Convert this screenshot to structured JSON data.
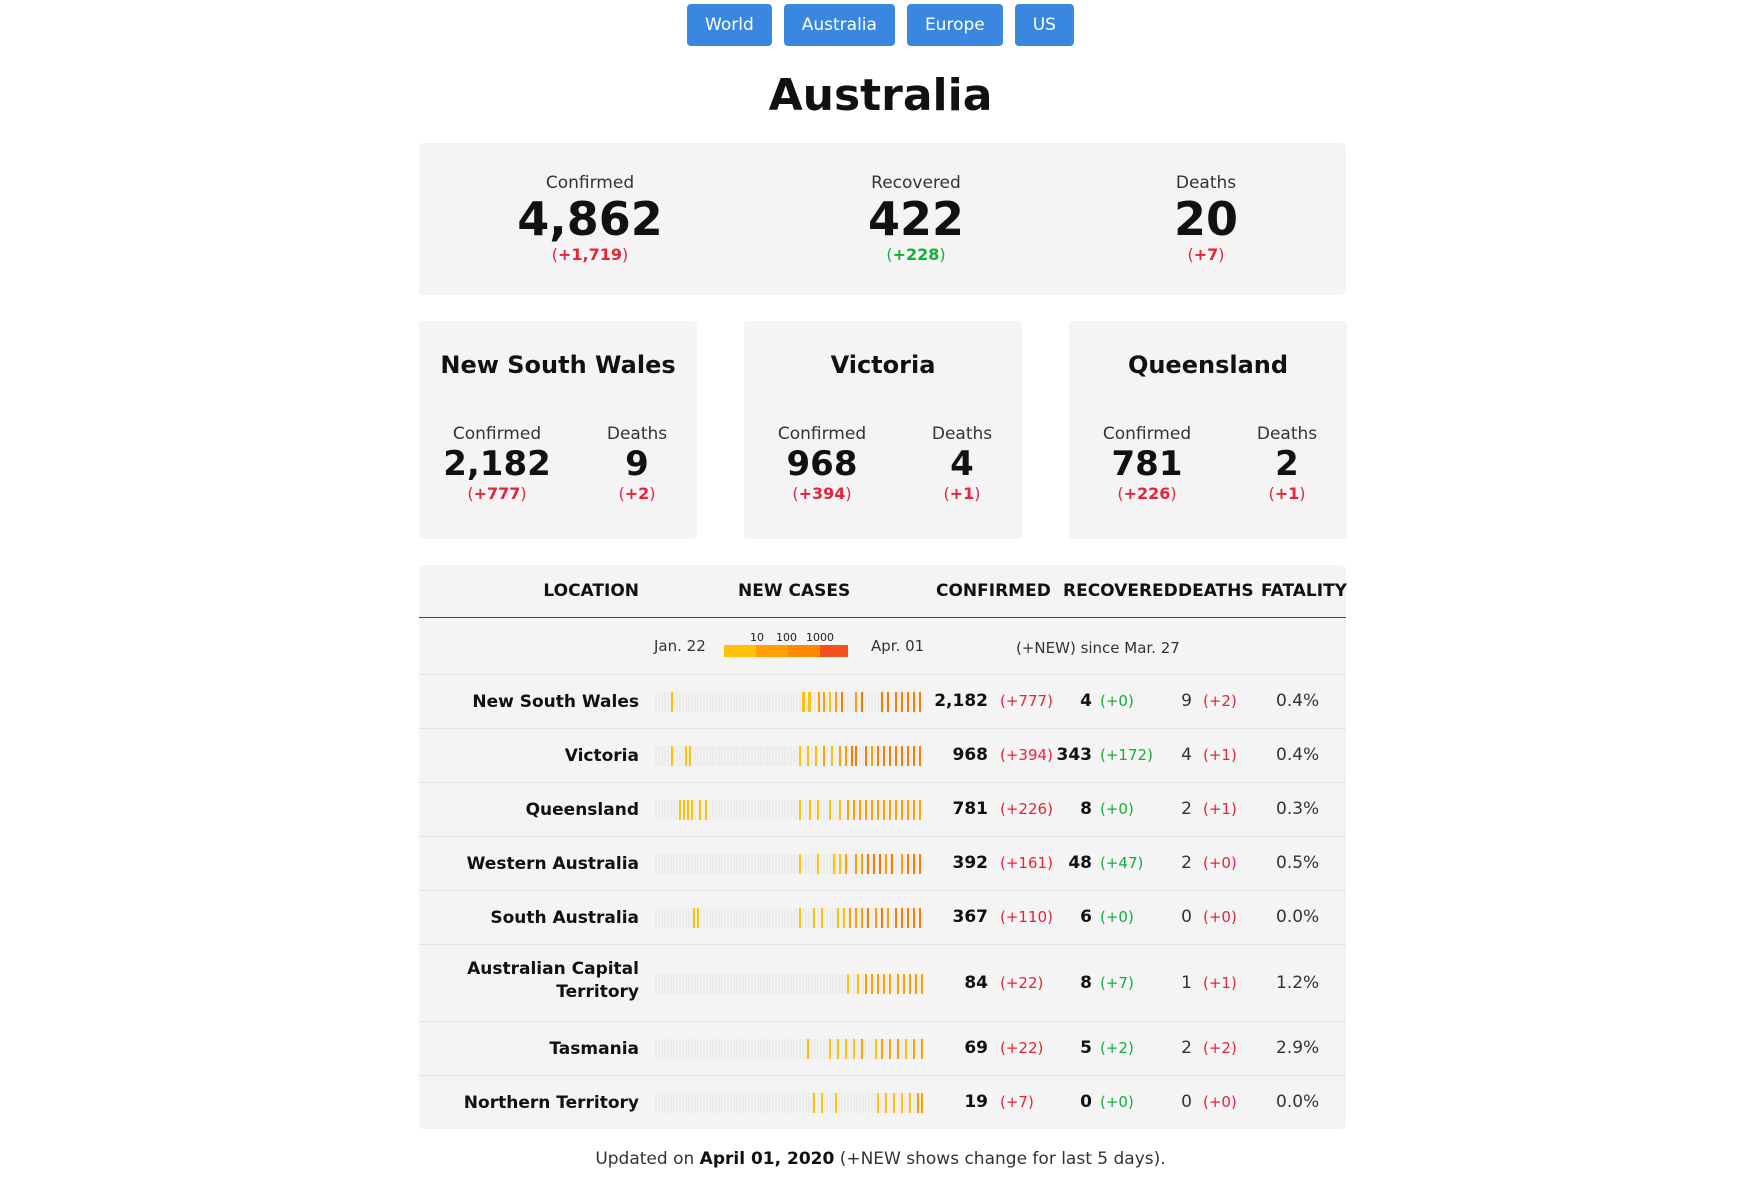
{
  "nav": [
    "World",
    "Australia",
    "Europe",
    "US"
  ],
  "title": "Australia",
  "summary": {
    "confirmed": {
      "label": "Confirmed",
      "value": "4,862",
      "change": "+1,719"
    },
    "recovered": {
      "label": "Recovered",
      "value": "422",
      "change": "+228"
    },
    "deaths": {
      "label": "Deaths",
      "value": "20",
      "change": "+7"
    }
  },
  "states": [
    {
      "name": "New South Wales",
      "confirmed_label": "Confirmed",
      "confirmed": "2,182",
      "confirmed_change": "+777",
      "deaths_label": "Deaths",
      "deaths": "9",
      "deaths_change": "+2"
    },
    {
      "name": "Victoria",
      "confirmed_label": "Confirmed",
      "confirmed": "968",
      "confirmed_change": "+394",
      "deaths_label": "Deaths",
      "deaths": "4",
      "deaths_change": "+1"
    },
    {
      "name": "Queensland",
      "confirmed_label": "Confirmed",
      "confirmed": "781",
      "confirmed_change": "+226",
      "deaths_label": "Deaths",
      "deaths": "2",
      "deaths_change": "+1"
    }
  ],
  "table": {
    "headers": {
      "location": "LOCATION",
      "new_cases": "NEW CASES",
      "confirmed": "CONFIRMED",
      "recovered": "RECOVERED",
      "deaths": "DEATHS",
      "fatality": "FATALITY"
    },
    "legend": {
      "start": "Jan. 22",
      "end": "Apr. 01",
      "scale": [
        "10",
        "100",
        "1000"
      ],
      "note": "(+NEW) since Mar. 27"
    },
    "rows": [
      {
        "location": "New South Wales",
        "confirmed": "2,182",
        "confirmed_change": "+777",
        "recovered": "4",
        "recovered_change": "+0",
        "deaths": "9",
        "deaths_change": "+2",
        "fatality": "0.4%",
        "spark": "0000X0000000000000000000000000000000000000000000000000000000000000000000000000000000000000000000000000000000000000000000000000000000000000000000000000000000000000000000000000000000000000000000000000000000000000000000000000000000000000000000000000000000000000000000000000000000000"
      },
      {
        "location": "Victoria",
        "confirmed": "968",
        "confirmed_change": "+394",
        "recovered": "343",
        "recovered_change": "+172",
        "deaths": "4",
        "deaths_change": "+1",
        "fatality": "0.4%"
      },
      {
        "location": "Queensland",
        "confirmed": "781",
        "confirmed_change": "+226",
        "recovered": "8",
        "recovered_change": "+0",
        "deaths": "2",
        "deaths_change": "+1",
        "fatality": "0.3%"
      },
      {
        "location": "Western Australia",
        "confirmed": "392",
        "confirmed_change": "+161",
        "recovered": "48",
        "recovered_change": "+47",
        "deaths": "2",
        "deaths_change": "+0",
        "fatality": "0.5%"
      },
      {
        "location": "South Australia",
        "confirmed": "367",
        "confirmed_change": "+110",
        "recovered": "6",
        "recovered_change": "+0",
        "deaths": "0",
        "deaths_change": "+0",
        "fatality": "0.0%"
      },
      {
        "location": "Australian Capital Territory",
        "confirmed": "84",
        "confirmed_change": "+22",
        "recovered": "8",
        "recovered_change": "+7",
        "deaths": "1",
        "deaths_change": "+1",
        "fatality": "1.2%"
      },
      {
        "location": "Tasmania",
        "confirmed": "69",
        "confirmed_change": "+22",
        "recovered": "5",
        "recovered_change": "+2",
        "deaths": "2",
        "deaths_change": "+2",
        "fatality": "2.9%"
      },
      {
        "location": "Northern Territory",
        "confirmed": "19",
        "confirmed_change": "+7",
        "recovered": "0",
        "recovered_change": "+0",
        "deaths": "0",
        "deaths_change": "+0",
        "fatality": "0.0%"
      }
    ]
  },
  "footer": {
    "prefix": "Updated on",
    "date": "April 01, 2020",
    "suffix": "(+NEW shows change for last 5 days)."
  },
  "colors": {
    "nav_button": "#3a87e0",
    "increase": "#e8233a",
    "recovered": "#12b03a",
    "panel": "#f4f4f4",
    "spark_low": "#ffc107",
    "spark_mid": "#ff9800",
    "spark_high": "#f4511e"
  }
}
